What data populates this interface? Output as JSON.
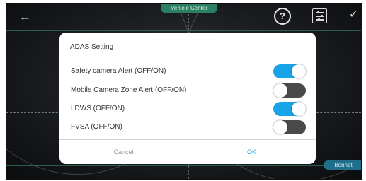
{
  "overlay": {
    "vehicle_center_label": "Vehicle Center",
    "bonnet_label": "Bonnet"
  },
  "toolbar": {
    "back_icon": "arrow-left-icon",
    "help_icon": "question-circle-icon",
    "help_glyph": "?",
    "settings_icon": "sliders-icon",
    "confirm_icon": "checkmark-icon"
  },
  "dialog": {
    "title": "ADAS Setting",
    "rows": [
      {
        "label": "Safety camera Alert (OFF/ON)",
        "state": "on"
      },
      {
        "label": "Mobile Camera Zone Alert (OFF/ON)",
        "state": "off"
      },
      {
        "label": "LDWS (OFF/ON)",
        "state": "on"
      },
      {
        "label": "FVSA (OFF/ON)",
        "state": "off"
      }
    ],
    "cancel_label": "Cancel",
    "ok_label": "OK"
  },
  "colors": {
    "toggle_on": "#1aa4e8",
    "toggle_off": "#4a4a4a",
    "ok_text": "#1aa4e8",
    "vehicle_center_bg": "#2b7f62",
    "bonnet_bg": "#1f6f8a"
  }
}
